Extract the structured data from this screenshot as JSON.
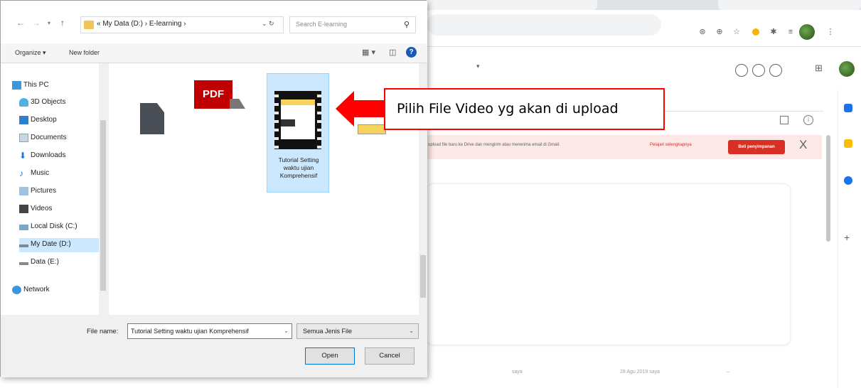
{
  "dialog": {
    "address_path": "« My Data (D:) › E-learning ›",
    "search_placeholder": "Search E-learning",
    "organize_label": "Organize ▾",
    "new_folder_label": "New folder",
    "nav_items": [
      {
        "label": "This PC",
        "icon": "pc-icon"
      },
      {
        "label": "3D Objects",
        "icon": "3d-objects-icon"
      },
      {
        "label": "Desktop",
        "icon": "desktop-icon"
      },
      {
        "label": "Documents",
        "icon": "documents-icon"
      },
      {
        "label": "Downloads",
        "icon": "downloads-icon"
      },
      {
        "label": "Music",
        "icon": "music-icon"
      },
      {
        "label": "Pictures",
        "icon": "pictures-icon"
      },
      {
        "label": "Videos",
        "icon": "videos-icon"
      },
      {
        "label": "Local Disk (C:)",
        "icon": "local-disk-icon"
      },
      {
        "label": "My Date (D:)",
        "icon": "drive-icon"
      },
      {
        "label": "Data (E:)",
        "icon": "drive-icon"
      },
      {
        "label": "Network",
        "icon": "network-icon"
      }
    ],
    "selected_nav": "My Date (D:)",
    "selected_file_label": "Tutorial Setting waktu ujian Komprehensif",
    "pdf_label": "PDF",
    "file_name_label": "File name:",
    "file_name_value": "Tutorial Setting waktu ujian Komprehensif",
    "file_type_value": "Semua Jenis File",
    "open_label": "Open",
    "cancel_label": "Cancel"
  },
  "annotation": {
    "text": "Pilih File Video yg akan di upload",
    "arrow_color": "#ff0000",
    "border_color": "#ff0000"
  },
  "background": {
    "banner_text": "upload file baru ke Drive dan mengirim atau menerima email di Gmail.",
    "banner_link": "Pelajari selengkapnya",
    "banner_button": "Beli penyimpanan",
    "banner_close": "X",
    "footer_owner": "saya",
    "footer_date": "28 Agu 2019 saya"
  },
  "colors": {
    "selection": "#cce8ff",
    "accent": "#0078d7",
    "banner_bg": "#fce8e6",
    "banner_btn": "#d93025"
  }
}
